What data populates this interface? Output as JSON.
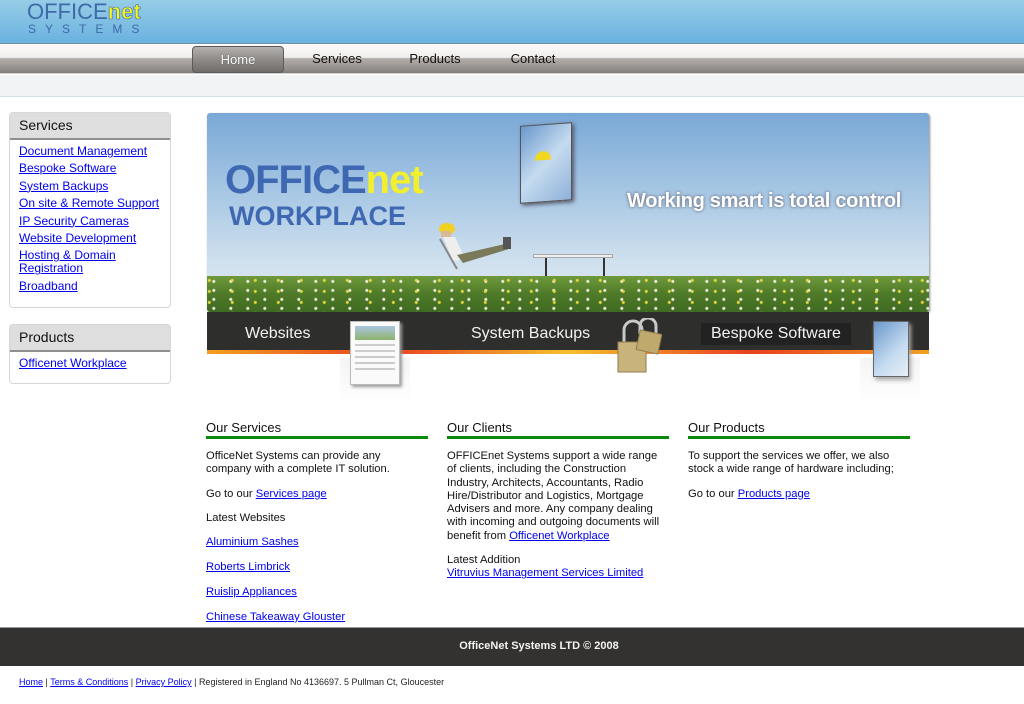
{
  "header": {
    "logo_office": "OFFICE",
    "logo_net": "net",
    "logo_systems": "SYSTEMS"
  },
  "nav": {
    "items": [
      {
        "label": "Home",
        "active": true
      },
      {
        "label": "Services",
        "active": false
      },
      {
        "label": "Products",
        "active": false
      },
      {
        "label": "Contact",
        "active": false
      }
    ]
  },
  "sidebar": {
    "services": {
      "title": "Services",
      "links": [
        "Document Management",
        "Bespoke Software",
        "System Backups",
        "On site & Remote Support",
        "IP Security Cameras",
        "Website Development",
        "Hosting & Domain Registration",
        "Broadband"
      ]
    },
    "products": {
      "title": "Products",
      "links": [
        "Officenet Workplace"
      ]
    }
  },
  "banner": {
    "title_office": "OFFICE",
    "title_net": "net",
    "title_workplace": "WORKPLACE",
    "tagline": "Working smart is total control",
    "features": [
      "Websites",
      "System Backups",
      "Bespoke Software"
    ]
  },
  "columns": {
    "services": {
      "title": "Our Services",
      "intro": "OfficeNet Systems can provide any company with a complete IT solution.",
      "goto_prefix": "Go to our ",
      "goto_link": "Services page",
      "latest_label": "Latest Websites",
      "latest_links": [
        "Aluminium Sashes",
        "Roberts Limbrick",
        "Ruislip Appliances",
        "Chinese Takeaway Glouster"
      ]
    },
    "clients": {
      "title": "Our Clients",
      "intro": "OFFICEnet Systems support a wide range of clients, including the Construction Industry, Architects, Accountants, Radio Hire/Distributor and Logistics, Mortgage Advisers and more. Any company dealing with incoming and outgoing documents will benefit from ",
      "intro_link": "Officenet Workplace",
      "latest_label": "Latest Addition",
      "latest_link": "Vitruvius Management Services Limited"
    },
    "products": {
      "title": "Our Products",
      "intro": "To support the services we offer, we also stock a wide range of hardware including;",
      "goto_prefix": "Go to our ",
      "goto_link": "Products page"
    }
  },
  "footer": {
    "copyright": "OfficeNet Systems LTD © 2008",
    "links": [
      "Home",
      "Terms & Conditions",
      "Privacy Policy"
    ],
    "separator": " | ",
    "registration": "Registered in England No 4136697. 5 Pullman Ct, Gloucester"
  },
  "colors": {
    "header_blue": "#6ab2e0",
    "logo_blue": "#3e6aa9",
    "logo_yellow": "#f5f520",
    "heading_rule_green": "#0a8a0a",
    "footer_dark": "#333231",
    "link": "#0000ee"
  }
}
